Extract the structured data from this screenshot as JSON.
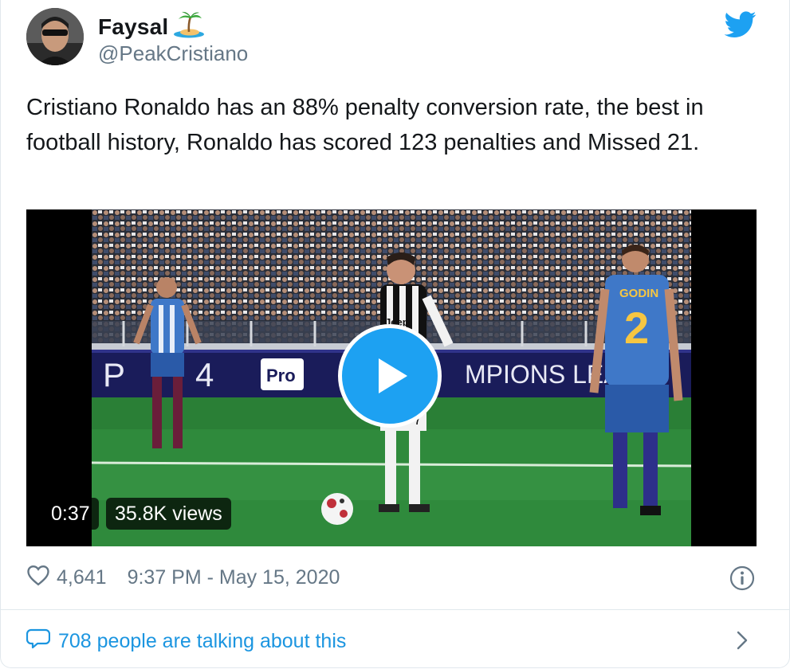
{
  "user": {
    "name": "Faysal",
    "name_emoji": "🏝",
    "handle": "@PeakCristiano"
  },
  "tweet": {
    "text": "Cristiano Ronaldo has an 88% penalty conversion rate, the best in football history, Ronaldo has scored 123 penalties and Missed 21."
  },
  "video": {
    "duration": "0:37",
    "views": "35.8K views",
    "scene": {
      "board_left": "P",
      "board_num": "4",
      "board_pro": "Pro",
      "board_right": "MPIONS LEAGU",
      "player_name": "GODIN",
      "player_number": "2",
      "center_number": "7",
      "sponsor": "Jeep"
    }
  },
  "footer": {
    "likes": "4,641",
    "timestamp": "9:37 PM - May 15, 2020",
    "talking": "708 people are talking about this"
  },
  "colors": {
    "accent": "#1da1f2",
    "link": "#1b95e0",
    "muted": "#657786",
    "border": "#e1e8ed"
  },
  "icons": [
    "twitter-bird-icon",
    "heart-icon",
    "info-icon",
    "speech-bubble-icon",
    "chevron-right-icon",
    "play-icon"
  ]
}
